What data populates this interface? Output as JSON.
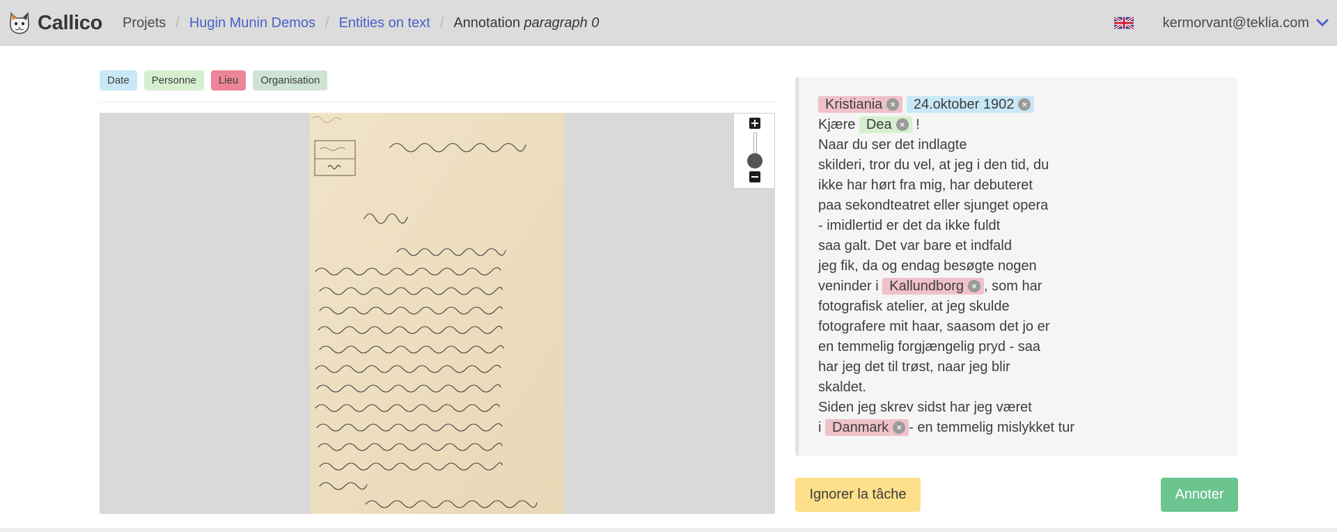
{
  "navbar": {
    "brand": "Callico",
    "logo_icon": "cat-logo-icon",
    "crumbs": {
      "projects": "Projets",
      "project": "Hugin Munin Demos",
      "process": "Entities on text",
      "current_prefix": "Annotation ",
      "current_element": "paragraph 0"
    },
    "language_icon": "uk-flag-icon",
    "user_email": "kermorvant@teklia.com",
    "user_menu_icon": "chevron-down-icon"
  },
  "entity_types": [
    {
      "label": "Date",
      "color": "#c9e8f6"
    },
    {
      "label": "Personne",
      "color": "#d6f0cf"
    },
    {
      "label": "Lieu",
      "color": "#ec8597"
    },
    {
      "label": "Organisation",
      "color": "#cfe3d4"
    }
  ],
  "viewer": {
    "zoom_in_icon": "plus-icon",
    "zoom_out_icon": "minus-icon"
  },
  "transcription": {
    "remove_icon": "close-circle-icon",
    "line1": {
      "ent1": "Kristiania",
      "ent2": "24.oktober 1902"
    },
    "line2": {
      "pre": "Kjære ",
      "ent": "Dea",
      "post": " !"
    },
    "line3": "Naar du ser det indlagte",
    "line4": "skilderi, tror du vel, at jeg i den tid, du",
    "line5": "ikke har hørt fra mig, har debuteret",
    "line6": "paa sekondteatret eller sjunget opera",
    "line7": "- imidlertid er det da ikke fuldt",
    "line8": "saa galt. Det var bare et indfald",
    "line9": "jeg fik, da og endag besøgte nogen",
    "line10": {
      "pre": "veninder i ",
      "ent": "Kallundborg",
      "post": ", som har"
    },
    "line11": "fotografisk atelier, at jeg skulde",
    "line12": "fotografere mit haar, saasom det jo er",
    "line13": "en temmelig forgjængelig pryd - saa",
    "line14": "har jeg det til trøst, naar jeg blir",
    "line15": "skaldet.",
    "line16": "Siden jeg skrev sidst har jeg været",
    "line17": {
      "pre": "i ",
      "ent": "Danmark",
      "post": "- en temmelig mislykket tur"
    }
  },
  "actions": {
    "ignore": "Ignorer la tâche",
    "annotate": "Annoter"
  }
}
